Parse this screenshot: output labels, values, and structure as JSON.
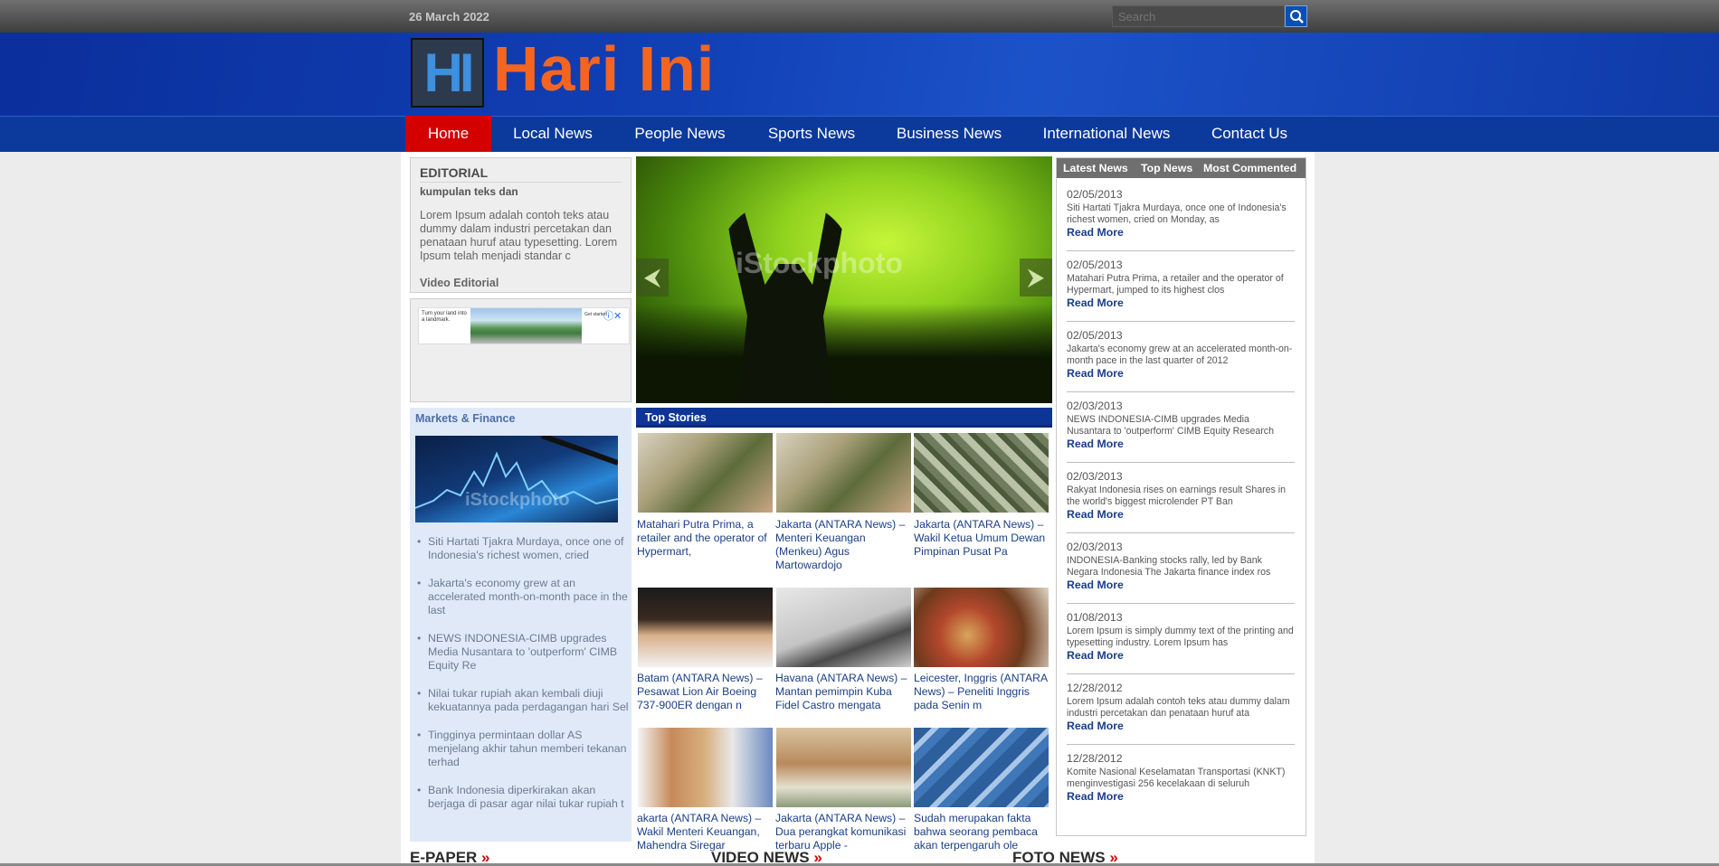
{
  "topbar": {
    "date": "26 March 2022",
    "search_placeholder": "Search"
  },
  "logo": {
    "mark": "HI",
    "name": "Hari Ini"
  },
  "nav": [
    "Home",
    "Local News",
    "People News",
    "Sports News",
    "Business News",
    "International News",
    "Contact Us"
  ],
  "editorial": {
    "title": "EDITORIAL",
    "subtitle": "kumpulan teks dan",
    "body": "Lorem Ipsum adalah contoh teks atau dummy dalam industri percetakan dan penataan huruf atau typesetting. Lorem Ipsum telah menjadi standar c",
    "video_link": "Video Editorial"
  },
  "ad": {
    "left_text": "Turn your land into a landmark.",
    "right_text": "Get started",
    "icons": "ⓘ✕"
  },
  "slider": {
    "watermark": "iStockphoto",
    "prev": "⮜",
    "next": "⮞"
  },
  "markets": {
    "title": "Markets & Finance",
    "watermark": "iStockphoto",
    "items": [
      "Siti Hartati Tjakra Murdaya, once one of Indonesia's richest women, cried",
      "Jakarta's economy grew at an accelerated month-on-month pace in the last",
      "NEWS INDONESIA-CIMB upgrades Media Nusantara to 'outperform' CIMB Equity Re",
      "Nilai tukar rupiah akan kembali diuji kekuatannya pada perdagangan hari Sel",
      "Tingginya permintaan dollar AS menjelang akhir tahun memberi tekanan terhad",
      "Bank Indonesia diperkirakan akan berjaga di pasar agar nilai tukar rupiah t"
    ]
  },
  "top_stories": {
    "title": "Top Stories",
    "items": [
      "Matahari Putra Prima, a retailer and the operator of Hypermart,",
      "Jakarta (ANTARA News) – Menteri Keuangan (Menkeu) Agus Martowardojo",
      "Jakarta (ANTARA News) – Wakil Ketua Umum Dewan Pimpinan Pusat Pa",
      "Batam (ANTARA News) – Pesawat Lion Air Boeing 737-900ER dengan n",
      "Havana (ANTARA News) – Mantan pemimpin Kuba Fidel Castro mengata",
      "Leicester, Inggris (ANTARA News) – Peneliti Inggris pada Senin m",
      "akarta (ANTARA News) – Wakil Menteri Keuangan, Mahendra Siregar",
      "Jakarta (ANTARA News) – Dua perangkat komunikasi terbaru Apple -",
      "Sudah merupakan fakta bahwa seorang pembaca akan terpengaruh ole"
    ]
  },
  "right_tabs": [
    "Latest News",
    "Top News",
    "Most Commented"
  ],
  "latest_news": [
    {
      "date": "02/05/2013",
      "text": "Siti Hartati Tjakra Murdaya, once one of Indonesia's richest women, cried on Monday, as",
      "more": "Read More"
    },
    {
      "date": "02/05/2013",
      "text": "Matahari Putra Prima, a retailer and the operator of Hypermart, jumped to its highest clos",
      "more": "Read More"
    },
    {
      "date": "02/05/2013",
      "text": "Jakarta's economy grew at an accelerated month-on-month pace in the last quarter of 2012",
      "more": "Read More"
    },
    {
      "date": "02/03/2013",
      "text": "NEWS INDONESIA-CIMB upgrades Media Nusantara to 'outperform' CIMB Equity Research upgraded",
      "more": "Read More"
    },
    {
      "date": "02/03/2013",
      "text": "Rakyat Indonesia rises on earnings result Shares in the world's biggest microlender PT Ban",
      "more": "Read More"
    },
    {
      "date": "02/03/2013",
      "text": "INDONESIA-Banking stocks rally, led by Bank Negara Indonesia The Jakarta finance index ros",
      "more": "Read More"
    },
    {
      "date": "01/08/2013",
      "text": "Lorem Ipsum is simply dummy text of the printing and typesetting industry. Lorem Ipsum has",
      "more": "Read More"
    },
    {
      "date": "12/28/2012",
      "text": "Lorem Ipsum adalah contoh teks atau dummy dalam industri percetakan dan penataan huruf ata",
      "more": "Read More"
    },
    {
      "date": "12/28/2012",
      "text": "Komite Nasional Keselamatan Transportasi (KNKT) menginvestigasi 256 kecelakaan di seluruh",
      "more": "Read More"
    }
  ],
  "sections": [
    "E-PAPER",
    "VIDEO NEWS",
    "FOTO NEWS"
  ],
  "section_chevron": "»",
  "colors": {
    "nav_active": "#d40000",
    "header_blue": "#1140b5",
    "logo_orange": "#f46522",
    "link": "#1a3e86"
  },
  "icons": {
    "search": "search-icon"
  }
}
